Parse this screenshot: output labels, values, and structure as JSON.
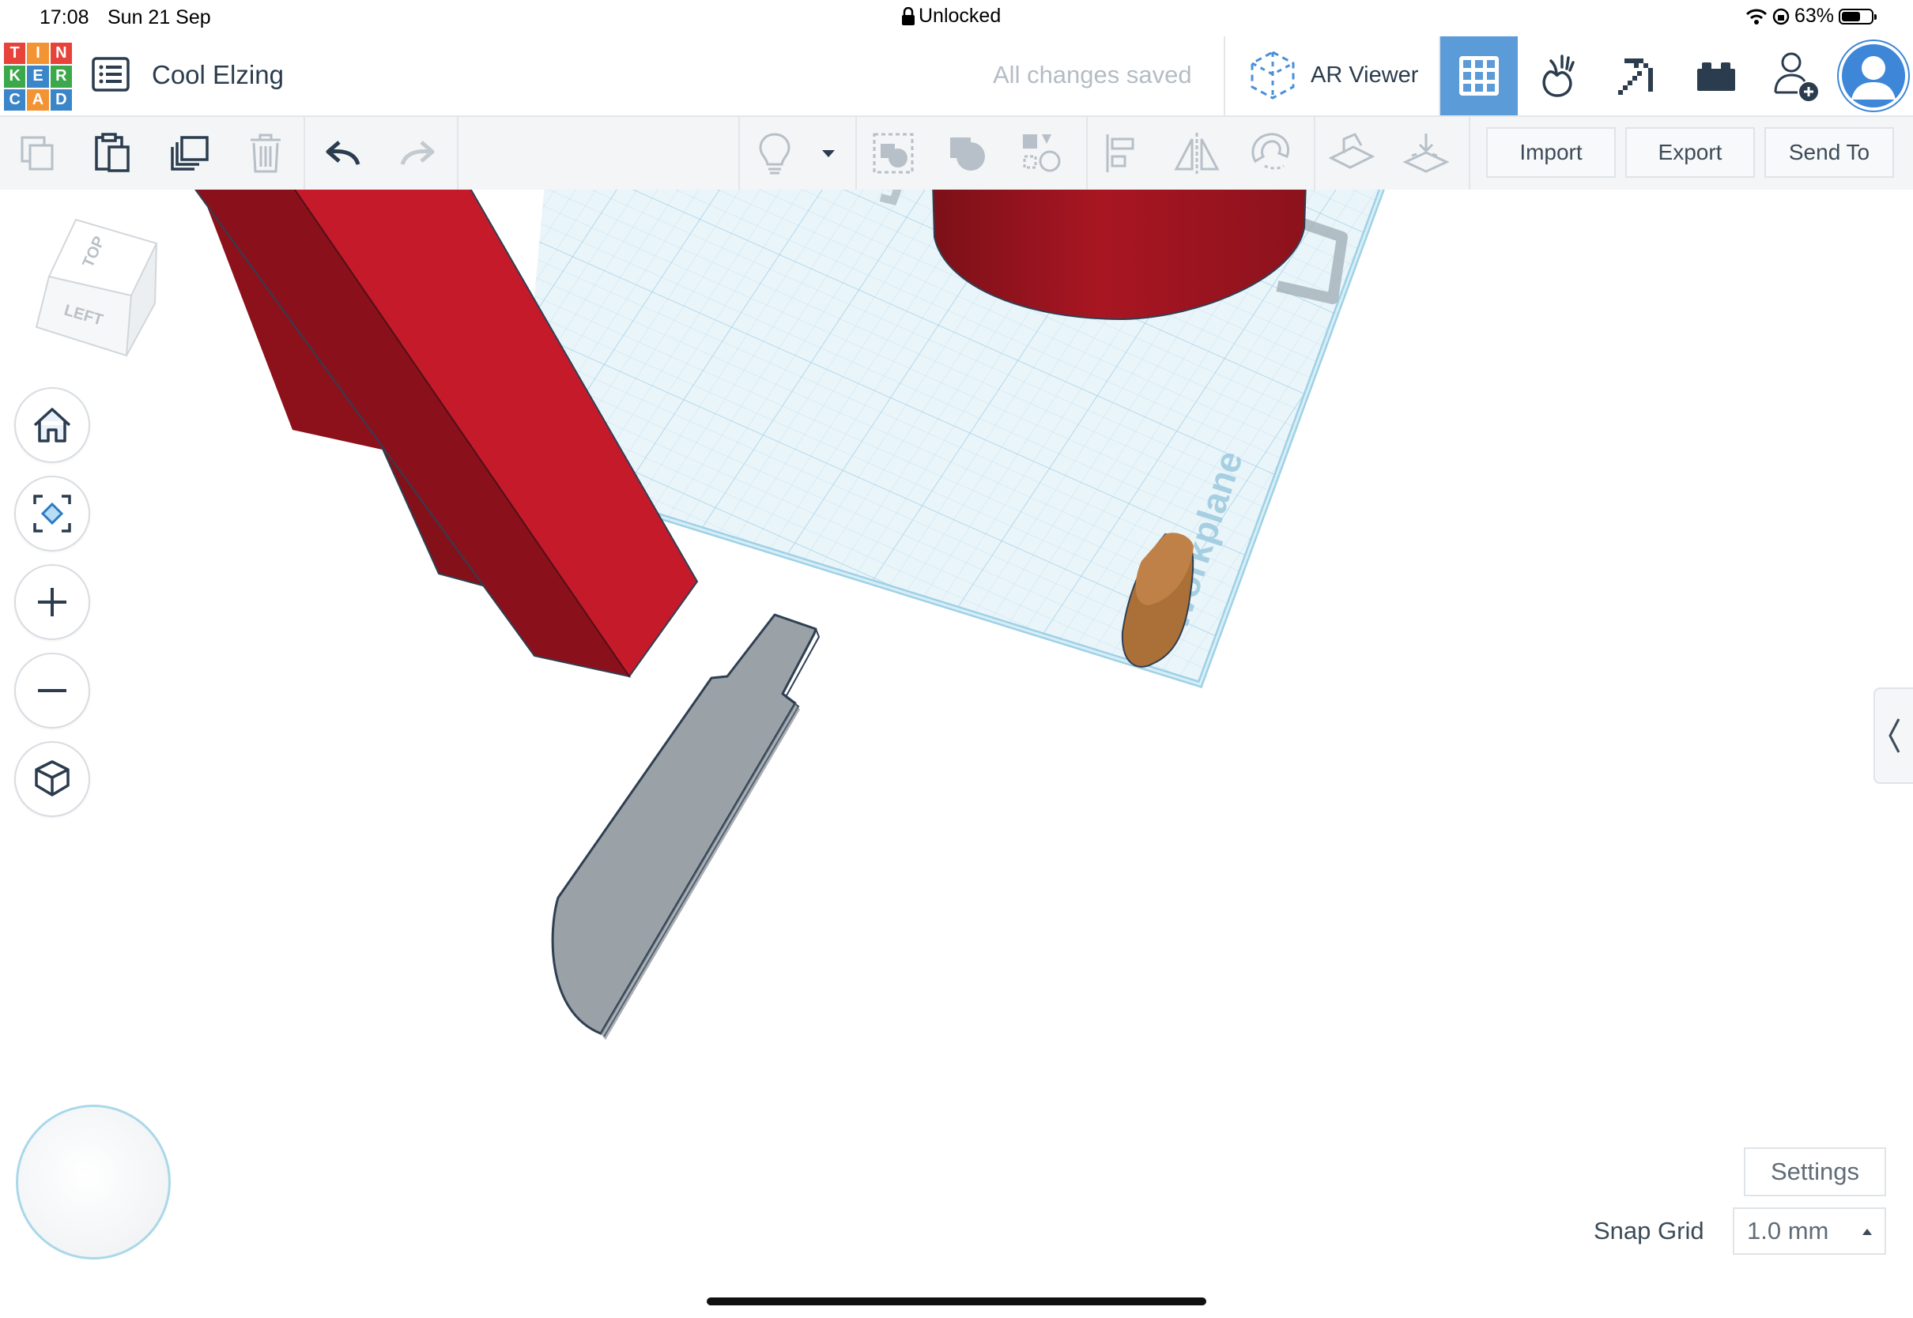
{
  "status_bar": {
    "time": "17:08",
    "date": "Sun 21 Sep",
    "lock_text": "Unlocked",
    "battery_percent": "63%",
    "battery_level": 0.63
  },
  "header": {
    "logo_letters": [
      "T",
      "I",
      "N",
      "K",
      "E",
      "R",
      "C",
      "A",
      "D"
    ],
    "logo_colors": [
      "#e8433a",
      "#f29433",
      "#e8433a",
      "#3aa84b",
      "#3a86c8",
      "#3aa84b",
      "#3a86c8",
      "#f29433",
      "#3a86c8"
    ],
    "project_title": "Cool Elzing",
    "save_status": "All changes saved",
    "ar_viewer_label": "AR Viewer",
    "accent_color": "#5b9bd8"
  },
  "toolbar": {
    "import_label": "Import",
    "export_label": "Export",
    "send_to_label": "Send To"
  },
  "workspace": {
    "view_cube": {
      "top_label": "TOP",
      "left_label": "LEFT"
    },
    "workplane_label": "Workplane",
    "settings_label": "Settings",
    "snap_grid_label": "Snap Grid",
    "snap_grid_value": "1.0 mm"
  }
}
